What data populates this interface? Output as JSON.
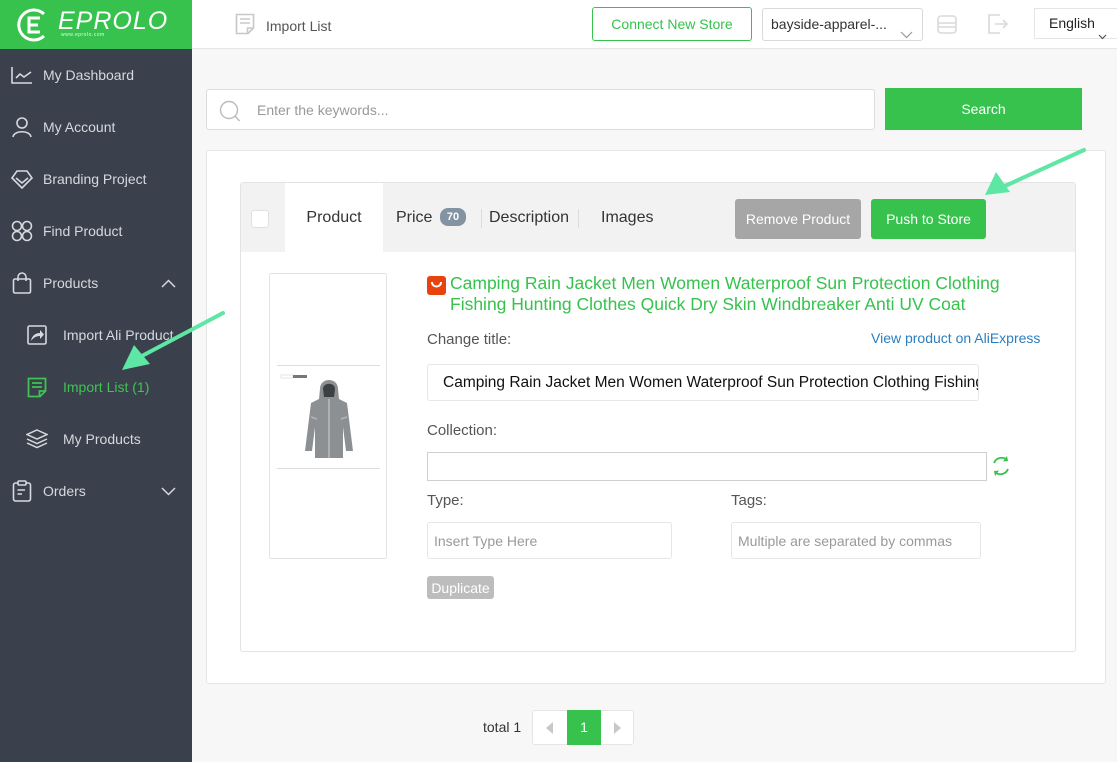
{
  "brand": {
    "name": "EPROLO",
    "sub": "www.eprolo.com",
    "accent": "#36c24d",
    "sidebar_bg": "#3a414c"
  },
  "sidebar": {
    "items": [
      {
        "label": "My Dashboard",
        "icon": "chart-line-icon"
      },
      {
        "label": "My Account",
        "icon": "user-icon"
      },
      {
        "label": "Branding Project",
        "icon": "diamond-icon"
      },
      {
        "label": "Find Product",
        "icon": "grid-circles-icon"
      },
      {
        "label": "Products",
        "icon": "bag-icon",
        "expanded": true
      },
      {
        "label": "Import Ali Product",
        "icon": "import-share-icon",
        "sub": true
      },
      {
        "label": "Import List (1)",
        "icon": "list-note-icon",
        "sub": true,
        "active": true
      },
      {
        "label": "My Products",
        "icon": "layers-icon",
        "sub": true
      },
      {
        "label": "Orders",
        "icon": "clipboard-icon",
        "expanded": false
      }
    ]
  },
  "topbar": {
    "breadcrumb": "Import List",
    "connect_store": "Connect New Store",
    "store_selected": "bayside-apparel-...",
    "language": "English"
  },
  "search": {
    "placeholder": "Enter the keywords...",
    "value": "",
    "button": "Search"
  },
  "product_card": {
    "tabs": [
      {
        "label": "Product",
        "active": true
      },
      {
        "label": "Price",
        "badge": "70"
      },
      {
        "label": "Description"
      },
      {
        "label": "Images"
      }
    ],
    "remove_button": "Remove Product",
    "push_button": "Push to Store",
    "title_line1": "Camping Rain Jacket Men Women Waterproof Sun Protection Clothing",
    "title_line2": "Fishing Hunting Clothes Quick Dry Skin Windbreaker Anti UV Coat",
    "change_title_label": "Change title:",
    "view_link": "View product on AliExpress",
    "title_value": "Camping Rain Jacket Men Women Waterproof Sun Protection Clothing Fishing Hunting Clothes Quick Dry Skin Windbreaker Anti UV Coat",
    "collection_label": "Collection:",
    "collection_value": "",
    "type_label": "Type:",
    "type_placeholder": "Insert Type Here",
    "tags_label": "Tags:",
    "tags_placeholder": "Multiple are separated by commas",
    "duplicate_button": "Duplicate"
  },
  "pagination": {
    "total_label": "total 1",
    "current_page": "1"
  }
}
